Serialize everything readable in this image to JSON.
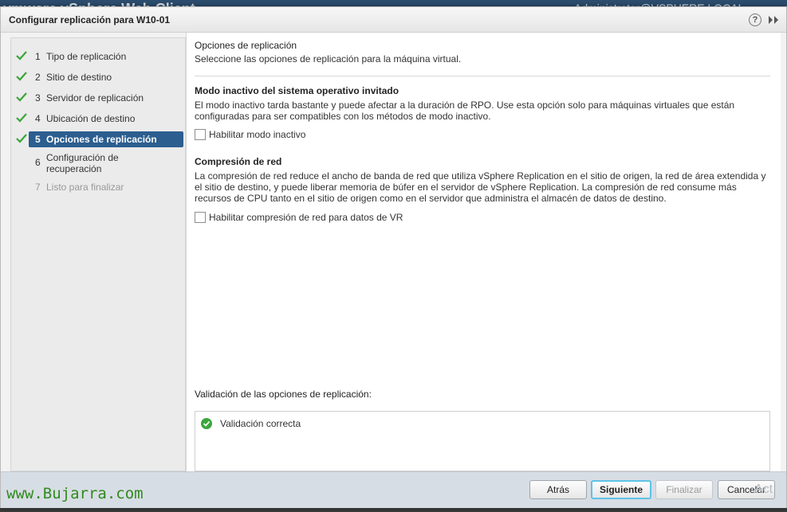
{
  "background": {
    "brand": "vmware vSphere Web Client",
    "user": "Administrator@VSPHERE.LOCAL"
  },
  "dialog": {
    "title": "Configurar replicación para W10-01",
    "help_icon": "?"
  },
  "steps": [
    {
      "num": "1",
      "label": "Tipo de replicación",
      "state": "done"
    },
    {
      "num": "2",
      "label": "Sitio de destino",
      "state": "done"
    },
    {
      "num": "3",
      "label": "Servidor de replicación",
      "state": "done"
    },
    {
      "num": "4",
      "label": "Ubicación de destino",
      "state": "done"
    },
    {
      "num": "5",
      "label": "Opciones de replicación",
      "state": "active"
    },
    {
      "num": "6",
      "label": "Configuración de recuperación",
      "state": "pending"
    },
    {
      "num": "7",
      "label": "Listo para finalizar",
      "state": "disabled"
    }
  ],
  "main": {
    "heading": "Opciones de replicación",
    "subheading": "Seleccione las opciones de replicación para la máquina virtual.",
    "quiesce": {
      "title": "Modo inactivo del sistema operativo invitado",
      "description": "El modo inactivo tarda bastante y puede afectar a la duración de RPO. Use esta opción solo para máquinas virtuales que están configuradas para ser compatibles con los métodos de modo inactivo.",
      "checkbox_label": "Habilitar modo inactivo",
      "checked": false
    },
    "compression": {
      "title": "Compresión de red",
      "description": "La compresión de red reduce el ancho de banda de red que utiliza vSphere Replication en el sitio de origen, la red de área extendida y el sitio de destino, y puede liberar memoria de búfer en el servidor de vSphere Replication. La compresión de red consume más recursos de CPU tanto en el sitio de origen como en el servidor que administra el almacén de datos de destino.",
      "checkbox_label": "Habilitar compresión de red para datos de VR",
      "checked": false
    },
    "validation": {
      "label": "Validación de las opciones de replicación:",
      "result": "Validación correcta"
    }
  },
  "footer": {
    "back_label": "Atrás",
    "next_label": "Siguiente",
    "finish_label": "Finalizar",
    "cancel_label": "Cancelar",
    "watermark": "www.Bujarra.com",
    "activate_text": "Act"
  },
  "colors": {
    "accent": "#2c5e8f",
    "check_green": "#3aa63a",
    "primary_border": "#5ec3e8"
  }
}
